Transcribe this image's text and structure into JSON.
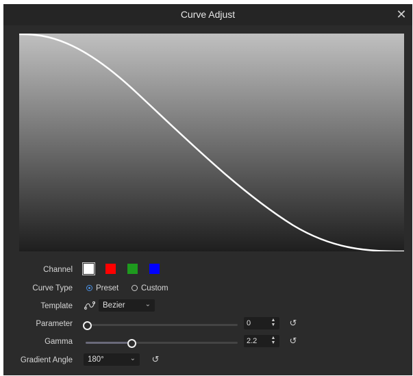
{
  "dialog": {
    "title": "Curve Adjust",
    "close_glyph": "✕"
  },
  "curve": {
    "description_points": [
      [
        0,
        1
      ],
      [
        0.5,
        0.5
      ],
      [
        1,
        0
      ]
    ],
    "gradient_top": "#c0c0c0",
    "gradient_bottom": "#1e1e1e",
    "line_color": "#ffffff"
  },
  "channel": {
    "label": "Channel",
    "swatches": [
      {
        "name": "white",
        "color": "#ffffff",
        "selected": true
      },
      {
        "name": "red",
        "color": "#ff0000",
        "selected": false
      },
      {
        "name": "green",
        "color": "#1e9a1e",
        "selected": false
      },
      {
        "name": "blue",
        "color": "#0000ff",
        "selected": false
      }
    ]
  },
  "curve_type": {
    "label": "Curve Type",
    "options": [
      {
        "label": "Preset",
        "checked": true
      },
      {
        "label": "Custom",
        "checked": false
      }
    ]
  },
  "template": {
    "label": "Template",
    "icon": "curve-template-icon",
    "value": "Bezier"
  },
  "parameter": {
    "label": "Parameter",
    "value": "0",
    "slider_fraction": 0.0
  },
  "gamma": {
    "label": "Gamma",
    "value": "2.2",
    "slider_fraction": 0.3
  },
  "gradient_angle": {
    "label": "Gradient Angle",
    "value": "180°"
  },
  "colors": {
    "accent": "#4a90e2",
    "panel": "#2b2b2b",
    "titlebar": "#252525"
  }
}
